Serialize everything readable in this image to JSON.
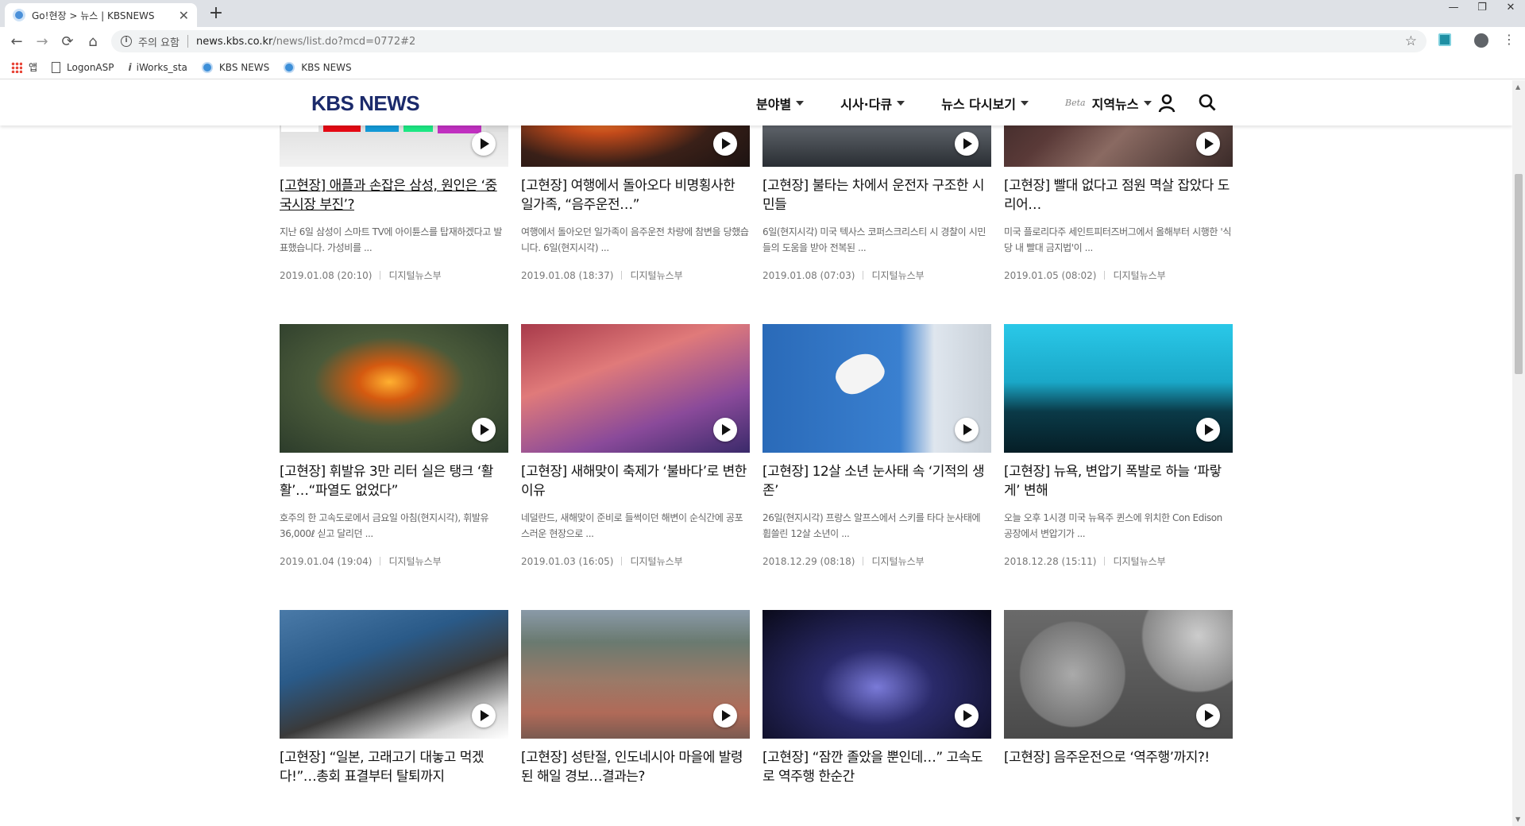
{
  "browser": {
    "tab_title": "Go!현장 > 뉴스 | KBSNEWS",
    "tab_close": "✕",
    "new_tab": "+",
    "window_controls": [
      "—",
      "❐",
      "✕"
    ],
    "nav": {
      "back": "←",
      "forward": "→",
      "reload": "⟳",
      "home": "⌂"
    },
    "security_label": "주의 요함",
    "url_host": "news.kbs.co.kr",
    "url_path": "/news/list.do?mcd=0772#2",
    "bookmarks": [
      {
        "label": "앱",
        "icon": "apps-icon"
      },
      {
        "label": "LogonASP",
        "icon": "page-icon"
      },
      {
        "label": "iWorks_sta",
        "icon": "iworks-icon"
      },
      {
        "label": "KBS NEWS",
        "icon": "kbs-favicon"
      },
      {
        "label": "KBS NEWS",
        "icon": "kbs-favicon"
      }
    ]
  },
  "site": {
    "logo": "KBS NEWS",
    "nav": [
      {
        "label": "분야별"
      },
      {
        "label": "시사·다큐"
      },
      {
        "label": "뉴스 다시보기"
      },
      {
        "label": "지역뉴스",
        "badge": "Beta"
      }
    ]
  },
  "articles": [
    {
      "title": "[고현장] 애플과 손잡은 삼성, 원인은 ‘중국시장 부진’?",
      "desc": "지난 6일 삼성이 스마트 TV에 아이튠스를 탑재하겠다고 발표했습니다. 가성비를 ...",
      "date": "2019.01.08 (20:10)",
      "author": "디지털뉴스부"
    },
    {
      "title": "[고현장] 여행에서 돌아오다 비명횡사한 일가족, “음주운전…”",
      "desc": "여행에서 돌아오던 일가족이 음주운전 차량에 참변을 당했습니다. 6일(현지시각) ...",
      "date": "2019.01.08 (18:37)",
      "author": "디지털뉴스부"
    },
    {
      "title": "[고현장] 불타는 차에서 운전자 구조한 시민들",
      "desc": "6일(현지시각) 미국 텍사스 코퍼스크리스티 시 경찰이 시민들의 도움을 받아 전복된 ...",
      "date": "2019.01.08 (07:03)",
      "author": "디지털뉴스부"
    },
    {
      "title": "[고현장] 빨대 없다고 점원 멱살 잡았다 도리어…",
      "desc": "미국 플로리다주 세인트피터즈버그에서 올해부터 시행한 '식당 내 빨대 금지법'이 ...",
      "date": "2019.01.05 (08:02)",
      "author": "디지털뉴스부"
    },
    {
      "title": "[고현장] 휘발유 3만 리터 실은 탱크 ‘활활’…“파열도 없었다”",
      "desc": "호주의 한 고속도로에서 금요일 아침(현지시각), 휘발유 36,000ℓ 싣고 달리던 ...",
      "date": "2019.01.04 (19:04)",
      "author": "디지털뉴스부"
    },
    {
      "title": "[고현장] 새해맞이 축제가 ‘불바다’로 변한 이유",
      "desc": "네덜란드, 새해맞이 준비로 들썩이던 해변이 순식간에 공포스러운 현장으로 ...",
      "date": "2019.01.03 (16:05)",
      "author": "디지털뉴스부"
    },
    {
      "title": "[고현장] 12살 소년 눈사태 속 ‘기적의 생존’",
      "desc": "26일(현지시각) 프랑스 알프스에서 스키를 타다 눈사태에 휩쓸린 12살 소년이 ...",
      "date": "2018.12.29 (08:18)",
      "author": "디지털뉴스부"
    },
    {
      "title": "[고현장] 뉴욕, 변압기 폭발로 하늘 ‘파랗게’ 변해",
      "desc": "오늘 오후 1시경 미국 뉴욕주 퀸스에 위치한 Con Edison 공장에서 변압기가 ...",
      "date": "2018.12.28 (15:11)",
      "author": "디지털뉴스부"
    },
    {
      "title": "[고현장] “일본, 고래고기 대놓고 먹겠다!”…총회 표결부터 탈퇴까지",
      "desc": "",
      "date": "",
      "author": ""
    },
    {
      "title": "[고현장] 성탄절, 인도네시아 마을에 발령된 해일 경보…결과는?",
      "desc": "",
      "date": "",
      "author": ""
    },
    {
      "title": "[고현장] “잠깐 졸았을 뿐인데…” 고속도로 역주행 한순간",
      "desc": "",
      "date": "",
      "author": ""
    },
    {
      "title": "[고현장] 음주운전으로 ‘역주행’까지?!",
      "desc": "",
      "date": "",
      "author": ""
    }
  ]
}
